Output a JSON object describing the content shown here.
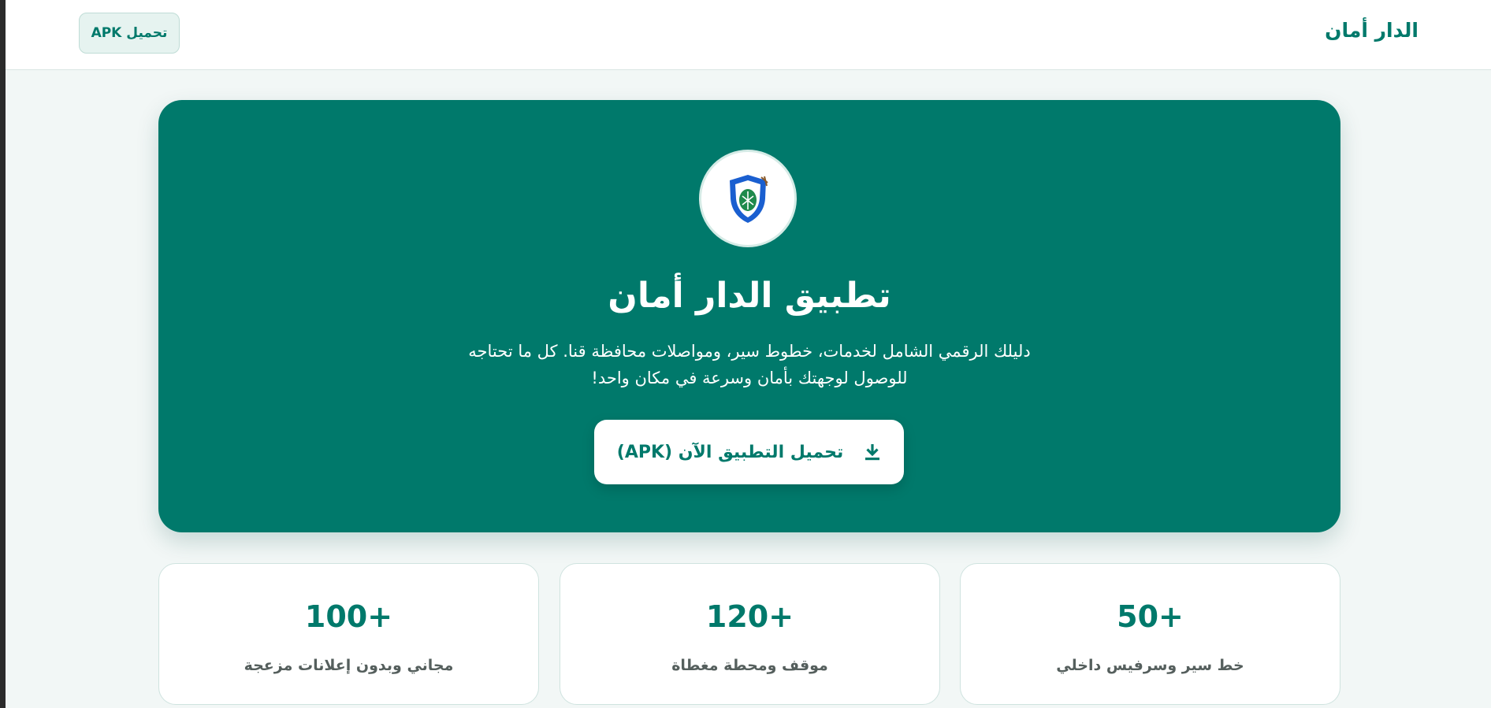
{
  "header": {
    "brand": "الدار أمان",
    "download_button": "تحميل APK"
  },
  "hero": {
    "logo_icon": "shield-leaf-icon",
    "title": "تطبيق الدار أمان",
    "description": "دليلك الرقمي الشامل لخدمات، خطوط سير، ومواصلات محافظة قنا. كل ما تحتاجه للوصول لوجهتك بأمان وسرعة في مكان واحد!",
    "download_label": "تحميل التطبيق الآن (APK)",
    "download_icon": "download-icon"
  },
  "stats": [
    {
      "value": "50+",
      "label": "خط سير وسرفيس داخلي"
    },
    {
      "value": "120+",
      "label": "موقف ومحطة مغطاة"
    },
    {
      "value": "100+",
      "label": "مجاني وبدون إعلانات مزعجة"
    }
  ],
  "colors": {
    "primary": "#00796b",
    "background": "#f2f7f6",
    "card": "#ffffff"
  }
}
